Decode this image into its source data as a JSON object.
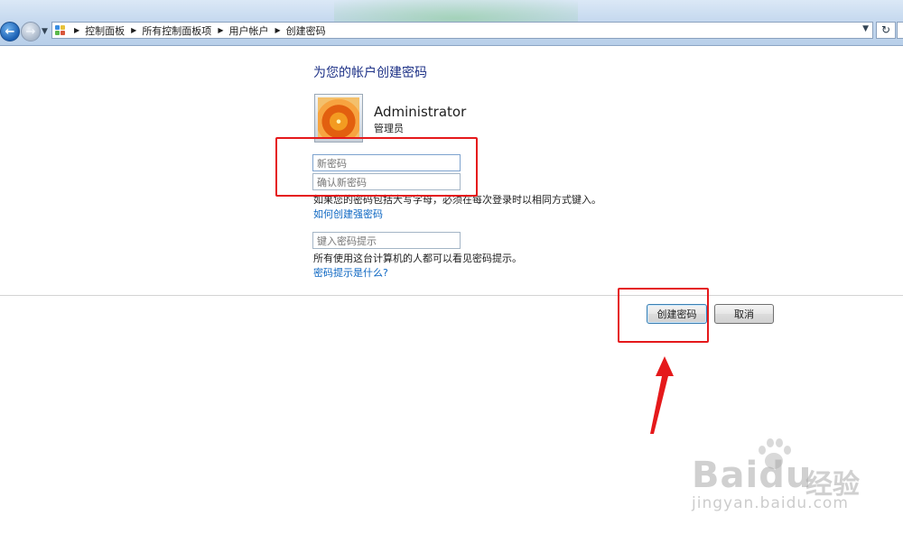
{
  "toolbar": {
    "breadcrumb": [
      "控制面板",
      "所有控制面板项",
      "用户帐户",
      "创建密码"
    ],
    "refresh_glyph": "↻",
    "forward_glyph": "→",
    "back_glyph": "←"
  },
  "page": {
    "heading": "为您的帐户创建密码",
    "user_name": "Administrator",
    "user_role": "管理员",
    "new_password_placeholder": "新密码",
    "confirm_password_placeholder": "确认新密码",
    "case_note": "如果您的密码包括大写字母，必须在每次登录时以相同方式键入。",
    "strong_password_link": "如何创建强密码",
    "hint_placeholder": "键入密码提示",
    "hint_note": "所有使用这台计算机的人都可以看见密码提示。",
    "hint_link": "密码提示是什么?"
  },
  "buttons": {
    "create": "创建密码",
    "cancel": "取消"
  },
  "watermark": {
    "logo": "Baidu",
    "cn": "经验",
    "url": "jingyan.baidu.com"
  },
  "colors": {
    "annotation_red": "#e5191b",
    "link_blue": "#0c66c2",
    "heading_blue": "#1e3287"
  }
}
